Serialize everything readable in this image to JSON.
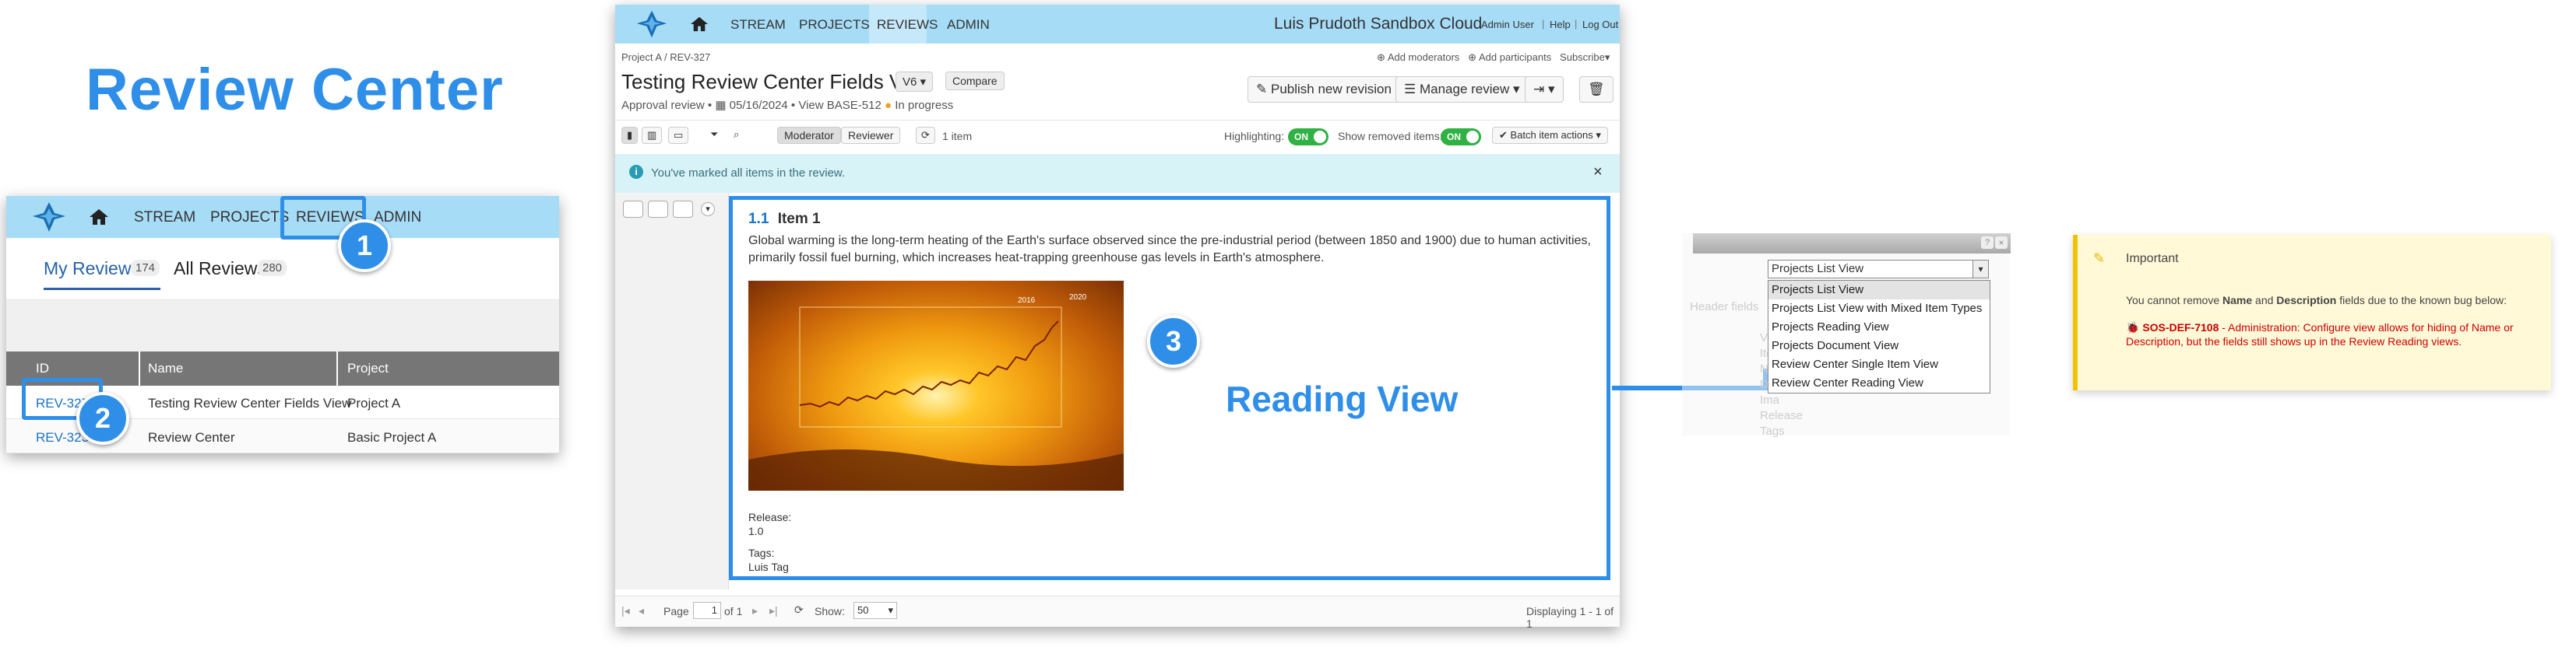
{
  "title": "Review Center",
  "left": {
    "nav": {
      "stream": "STREAM",
      "projects": "PROJECTS",
      "reviews": "REVIEWS",
      "admin": "ADMIN"
    },
    "tabs": {
      "my_reviews": "My Reviews",
      "my_count": "174",
      "all_reviews": "All Reviews",
      "all_count": "280"
    },
    "columns": {
      "id": "ID",
      "name": "Name",
      "project": "Project"
    },
    "rows": [
      {
        "id": "REV-327",
        "name": "Testing Review Center Fields View",
        "project": "Project A"
      },
      {
        "id": "REV-323",
        "name": "Review Center",
        "project": "Basic Project A"
      }
    ]
  },
  "callouts": {
    "one": "1",
    "two": "2",
    "three": "3"
  },
  "main": {
    "nav": {
      "stream": "STREAM",
      "projects": "PROJECTS",
      "reviews": "REVIEWS",
      "admin": "ADMIN",
      "org": "Luis Prudoth Sandbox Cloud",
      "admin_user": "Admin User",
      "help": "Help",
      "logout": "Log Out"
    },
    "breadcrumb": {
      "project": "Project A",
      "sep": "/",
      "rev": "REV-327"
    },
    "actions": {
      "add_moderators": "Add moderators",
      "add_participants": "Add participants",
      "subscribe": "Subscribe"
    },
    "review_title": "Testing Review Center Fields View",
    "version": "V6",
    "compare": "Compare",
    "meta": {
      "type": "Approval review",
      "date": "05/16/2024",
      "view": "View BASE-512",
      "status": "In progress"
    },
    "publish": "Publish new revision",
    "manage": "Manage review",
    "toolbar": {
      "moderator": "Moderator",
      "reviewer": "Reviewer",
      "items": "1 item",
      "highlighting": "Highlighting:",
      "show_removed": "Show removed items:",
      "on": "ON",
      "batch": "Batch item actions"
    },
    "alert": "You've marked all items in the review.",
    "item": {
      "number": "1.1",
      "title": "Item 1",
      "description": "Global warming is the long-term heating of the Earth's surface observed since the pre-industrial period (between 1850 and 1900) due to human activities, primarily fossil fuel burning, which increases heat-trapping greenhouse gas levels in Earth's atmosphere.",
      "image_labels": {
        "y2016": "2016",
        "y2020": "2020"
      },
      "release_label": "Release:",
      "release_value": "1.0",
      "tags_label": "Tags:",
      "tags_value": "Luis Tag"
    },
    "footer": {
      "page": "Page",
      "page_value": "1",
      "of": "of 1",
      "show": "Show:",
      "show_value": "50",
      "displaying": "Displaying 1 - 1 of 1"
    }
  },
  "reading_view": "Reading View",
  "dropdown": {
    "selected": "Projects List View",
    "options": [
      "Projects List View",
      "Projects List View with Mixed Item Types",
      "Projects Reading View",
      "Projects Document View",
      "Review Center Single Item View",
      "Review Center Reading View"
    ]
  },
  "important": {
    "heading": "Important",
    "body_pre": "You cannot remove ",
    "name": "Name",
    "and": " and ",
    "description": "Description",
    "body_post": " fields due to the known bug below:",
    "bug_id": "SOS-DEF-7108",
    "bug_text": " - Administration: Configure view allows for hiding of Name or Description, but the fields still shows up in the Review Reading views."
  },
  "colors": {
    "accent": "#2f8fe8",
    "navbar": "#a7dcf7",
    "toggle": "#2fb144",
    "important_bg": "#fff9d8",
    "bug_red": "#cc0000"
  }
}
